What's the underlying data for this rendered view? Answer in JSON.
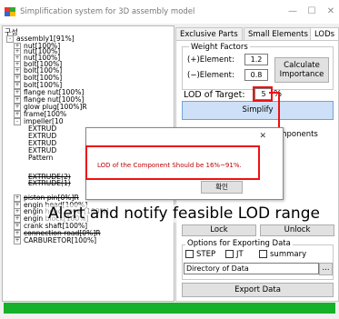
{
  "window": {
    "title": "Simplification system for 3D assembly model",
    "minimize": "—",
    "maximize": "☐",
    "close": "✕"
  },
  "tree": {
    "header": "구성",
    "items": [
      {
        "label": "assembly1[91%]",
        "exp": "-",
        "strike": false
      },
      {
        "label": "nut[100%]",
        "exp": "+",
        "strike": false
      },
      {
        "label": "nut[100%]",
        "exp": "+",
        "strike": false
      },
      {
        "label": "nut[100%]",
        "exp": "+",
        "strike": false
      },
      {
        "label": "bolt[100%]",
        "exp": "+",
        "strike": false
      },
      {
        "label": "bolt[100%]",
        "exp": "+",
        "strike": false
      },
      {
        "label": "bolt[100%]",
        "exp": "+",
        "strike": false
      },
      {
        "label": "bolt[100%]",
        "exp": "+",
        "strike": false
      },
      {
        "label": "flange nut[100%]",
        "exp": "+",
        "strike": false
      },
      {
        "label": "flange nut[100%]",
        "exp": "+",
        "strike": false
      },
      {
        "label": "glow plug[100%]R",
        "exp": "+",
        "strike": false
      },
      {
        "label": "frame[100%",
        "exp": "+",
        "strike": false
      },
      {
        "label": "impeller[10",
        "exp": "-",
        "strike": false
      },
      {
        "label": "EXTRUD",
        "exp": "",
        "strike": false
      },
      {
        "label": "EXTRUD",
        "exp": "",
        "strike": false
      },
      {
        "label": "EXTRUD",
        "exp": "",
        "strike": false
      },
      {
        "label": "EXTRUD",
        "exp": "",
        "strike": false
      },
      {
        "label": "Pattern",
        "exp": "",
        "strike": false
      },
      {
        "label": "EXTRUDE(2)",
        "exp": "",
        "strike": true
      },
      {
        "label": "EXTRUDE(1)",
        "exp": "",
        "strike": true
      },
      {
        "label": "piston pin[0%]R",
        "exp": "+",
        "strike": true
      },
      {
        "label": "engin head[100%]",
        "exp": "+",
        "strike": false
      },
      {
        "label": "engin head cover[100%]",
        "exp": "+",
        "strike": false
      },
      {
        "label": "engin block[100%]",
        "exp": "+",
        "strike": false
      },
      {
        "label": "crank shaft[100%]",
        "exp": "+",
        "strike": false
      },
      {
        "label": "connection road[0%]R",
        "exp": "+",
        "strike": true
      },
      {
        "label": "CARBURETOR[100%]",
        "exp": "+",
        "strike": false
      }
    ]
  },
  "tabs": [
    "Exclusive Parts",
    "Small Elements",
    "LODs"
  ],
  "lods": {
    "weight_factors_label": "Weight Factors",
    "plus_label": "(+)Element:",
    "plus_value": "1.2",
    "minus_label": "(−)Element:",
    "minus_value": "0.8",
    "calc_button_line1": "Calculate",
    "calc_button_line2": "Importance",
    "target_label": "LOD of Target:",
    "target_value": "5",
    "target_unit": "%",
    "simplify_button": "Simplify",
    "components_label": "omponents",
    "lock_button": "Lock",
    "unlock_button": "Unlock",
    "export_group_label": "Options for Exporting Data",
    "step_label": "STEP",
    "jt_label": "JT",
    "summary_label": "summary",
    "directory_value": "Directory of Data",
    "browse_button": "...",
    "export_button": "Export Data"
  },
  "dialog": {
    "close": "✕",
    "message": "LOD of the Component Should be 16%~91%.",
    "ok_button": "확인"
  },
  "annotation": {
    "callout": "Alert and notify feasible LOD range"
  },
  "colors": {
    "status_bar": "#16b12a",
    "highlight": "#e11111",
    "dialog_text": "#c00000"
  }
}
